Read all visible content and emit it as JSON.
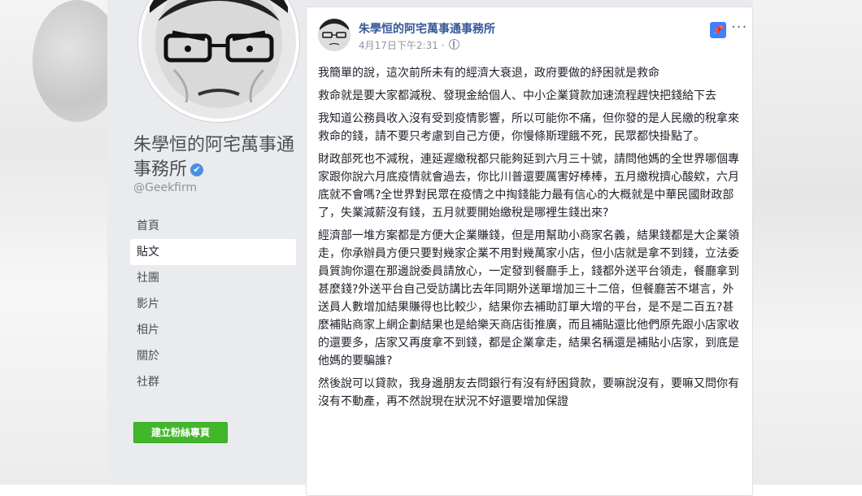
{
  "page": {
    "name": "朱學恒的阿宅萬事通事務所",
    "handle": "@Geekfirm",
    "verified_icon": "check-badge-icon"
  },
  "nav": {
    "items": [
      "首頁",
      "貼文",
      "社團",
      "影片",
      "相片",
      "關於",
      "社群"
    ],
    "active": "貼文"
  },
  "create_button": "建立粉絲專頁",
  "post": {
    "author": "朱學恒的阿宅萬事通事務所",
    "timestamp": "4月17日下午2:31 ·",
    "paragraphs": [
      "我簡單的說，這次前所未有的經濟大衰退，政府要做的紓困就是救命",
      "救命就是要大家都減稅、發現金給個人、中小企業貸款加速流程趕快把錢給下去",
      "我知道公務員收入沒有受到疫情影響，所以可能你不痛，但你發的是人民繳的稅拿來救命的錢，請不要只考慮到自己方便，你慢條斯理餓不死，民眾都快掛點了。",
      "財政部死也不減稅，連延遲繳稅都只能夠延到六月三十號，請問他媽的全世界哪個專家跟你說六月底疫情就會過去，你比川普還要厲害好棒棒，五月繳稅擠心酸欸，六月底就不會嗎?全世界對民眾在疫情之中掏錢能力最有信心的大概就是中華民國財政部了，失業減薪沒有錢，五月就要開始繳稅是哪裡生錢出來?",
      "經濟部一堆方案都是方便大企業賺錢，但是用幫助小商家名義，結果錢都是大企業領走，你承辦員方便只要對幾家企業不用對幾萬家小店，但小店就是拿不到錢，立法委員質詢你還在那邊說委員請放心，一定發到餐廳手上，錢都外送平台領走，餐廳拿到甚麼錢?外送平台自己受訪講比去年同期外送單增加三十二倍，但餐廳苦不堪言，外送員人數增加結果賺得也比較少，結果你去補助訂單大增的平台，是不是二百五?甚麼補貼商家上網企劃結果也是給樂天商店街推廣，而且補貼還比他們原先跟小店家收的還要多，店家又再度拿不到錢，都是企業拿走，結果名稱還是補貼小店家，到底是他媽的要騙誰?",
      "然後說可以貸款，我身邊朋友去問銀行有沒有紓困貸款，要嘛說沒有，要嘛又問你有沒有不動產，再不然說現在狀況不好還要增加保證"
    ]
  },
  "icons": {
    "pin": "pin-icon",
    "more": "more-icon",
    "audience": "globe-icon"
  },
  "colors": {
    "link": "#365899",
    "create_button": "#42b72a",
    "pin": "#4080ff",
    "page_bg": "#e9ebee"
  }
}
